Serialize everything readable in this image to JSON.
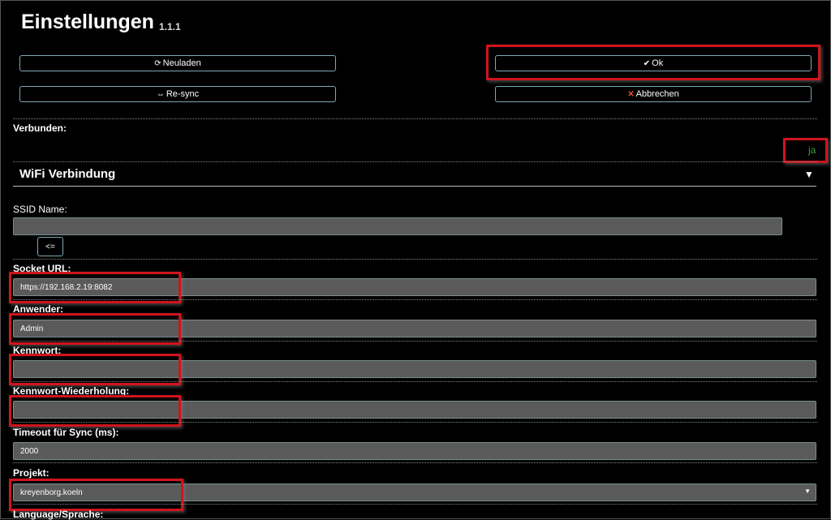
{
  "header": {
    "title": "Einstellungen",
    "version": "1.1.1"
  },
  "buttons": {
    "reload": {
      "icon": "⟳",
      "label": "Neuladen"
    },
    "ok": {
      "icon": "✔",
      "label": "Ok"
    },
    "resync": {
      "icon": "⇔",
      "label": "Re-sync"
    },
    "cancel": {
      "icon": "✕",
      "label": "Abbrechen"
    }
  },
  "connection": {
    "label": "Verbunden:",
    "value": "ja",
    "value_color": "#3c9c3c"
  },
  "wifi_section": {
    "title": "WiFi Verbindung",
    "toggle_icon": "▼"
  },
  "fields": {
    "ssid": {
      "label": "SSID Name:",
      "value": "",
      "button": "<="
    },
    "socket_url": {
      "label": "Socket URL:",
      "value": "https://192.168.2.19:8082"
    },
    "user": {
      "label": "Anwender:",
      "value": "Admin"
    },
    "password": {
      "label": "Kennwort:",
      "value": ""
    },
    "password_repeat": {
      "label": "Kennwort-Wiederholung:",
      "value": ""
    },
    "timeout": {
      "label": "Timeout für Sync (ms):",
      "value": "2000"
    },
    "project": {
      "label": "Projekt:",
      "value": "kreyenborg.koeln"
    },
    "language": {
      "label": "Language/Sprache:"
    }
  },
  "colors": {
    "highlight": "#d0141c",
    "input_bg": "#5a5a5a",
    "background": "#000000"
  }
}
